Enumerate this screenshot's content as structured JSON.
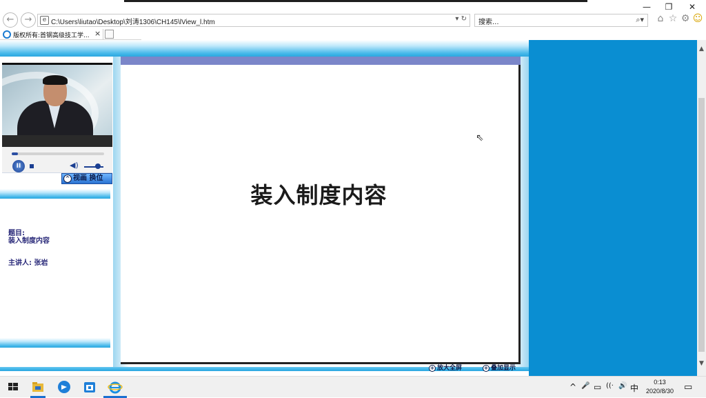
{
  "browser": {
    "address_url": "C:\\Users\\liutao\\Desktop\\刘涛1306\\CH145\\lView_l.htm",
    "address_tools": "▾ ↻",
    "search_placeholder": "搜索...",
    "search_icon_glyph": "⌕▾",
    "tab_title": "版权所有:首钢高级技工学...",
    "tab_close": "×",
    "back_glyph": "←",
    "forward_glyph": "→",
    "favicon_glyph": "e",
    "window_controls": {
      "minimize": "—",
      "restore": "❐",
      "close": "✕"
    },
    "toolbar_icons": {
      "home": "⌂",
      "favorites": "☆",
      "settings": "⚙",
      "smiley": "☺"
    }
  },
  "left_panel": {
    "video_controls": {
      "pause_glyph": "II",
      "volume_glyph": "◀)",
      "progress_fraction": 0.07,
      "volume_fraction": 0.7
    },
    "swap_button": {
      "label": "视画 换位",
      "icon_glyph": "^"
    },
    "topic_label": "题目:",
    "topic_value": "装入制度内容",
    "speaker": "主讲人: 张岩"
  },
  "slide": {
    "title": "装入制度内容",
    "zoom_button": "放大全屏",
    "overlay_button": "叠加显示",
    "button_icon_glyph": "+"
  },
  "scrollbar": {
    "up_glyph": "▲",
    "down_glyph": "▼"
  },
  "cursor_glyph": "⇖",
  "taskbar": {
    "tray_icons": [
      "^",
      "🎤",
      "▭",
      "((·",
      "🔊",
      "中"
    ],
    "time": "0:13",
    "date": "2020/8/30",
    "notify_glyph": "▭"
  },
  "colors": {
    "side_panel": "#0a8ed2",
    "slide_top_bar": "#7b86c9",
    "gradient_band": "#2aa7df",
    "text_navy": "#2a2a7a"
  }
}
